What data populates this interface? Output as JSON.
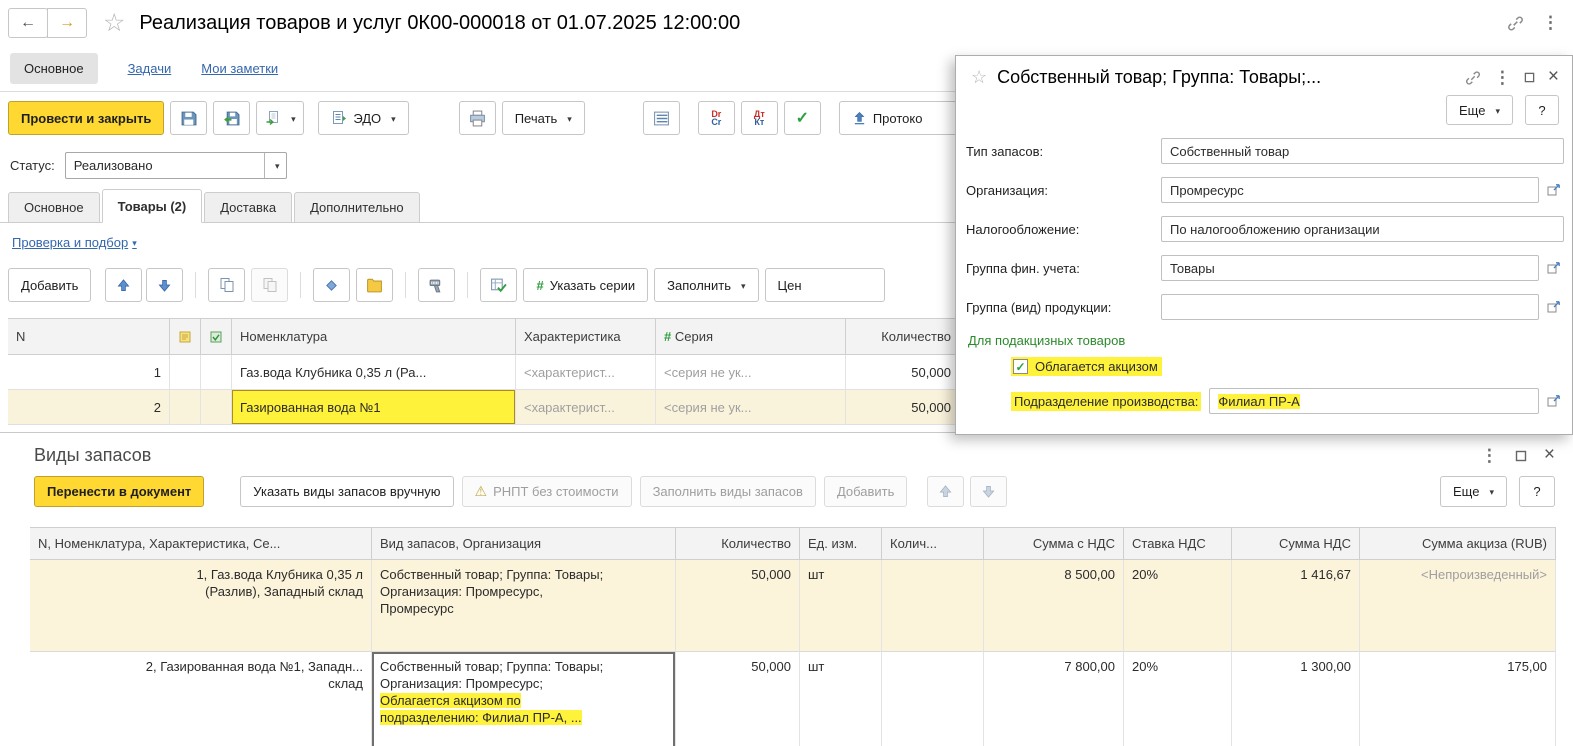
{
  "window": {
    "title": "Реализация товаров и услуг 0К00-000018 от 01.07.2025 12:00:00"
  },
  "nav": {
    "main": "Основное",
    "tasks": "Задачи",
    "notes": "Мои заметки"
  },
  "toolbar": {
    "post_and_close": "Провести и закрыть",
    "edo": "ЭДО",
    "print": "Печать",
    "dr_top": "Dr",
    "dr_bottom": "Cr",
    "dt_top": "Дт",
    "dt_bottom": "Кт",
    "protocol": "Протоко"
  },
  "status": {
    "label": "Статус:",
    "value": "Реализовано"
  },
  "doc_tabs": {
    "main": "Основное",
    "goods": "Товары (2)",
    "delivery": "Доставка",
    "additional": "Дополнительно"
  },
  "links": {
    "check_and_pick": "Проверка и подбор"
  },
  "items": {
    "toolbar": {
      "add": "Добавить",
      "specify_series": "Указать серии",
      "fill": "Заполнить",
      "prices": "Цен"
    },
    "headers": {
      "n": "N",
      "nomenclature": "Номенклатура",
      "characteristic": "Характеристика",
      "series": "Серия",
      "quantity": "Количество"
    },
    "rows": [
      {
        "n": "1",
        "nomenclature": "Газ.вода Клубника 0,35 л (Ра...",
        "characteristic": "<характерист...",
        "series": "<серия не ук...",
        "quantity": "50,000"
      },
      {
        "n": "2",
        "nomenclature": "Газированная вода №1",
        "characteristic": "<характерист...",
        "series": "<серия не ук...",
        "quantity": "50,000"
      }
    ]
  },
  "card": {
    "title": "Собственный товар; Группа: Товары;...",
    "more": "Еще",
    "help": "?",
    "type_label": "Тип запасов:",
    "type_value": "Собственный товар",
    "org_label": "Организация:",
    "org_value": "Промресурс",
    "tax_label": "Налогообложение:",
    "tax_value": "По налогообложению организации",
    "fin_group_label": "Группа фин. учета:",
    "fin_group_value": "Товары",
    "prod_group_label": "Группа (вид) продукции:",
    "prod_group_value": "",
    "excise_group": "Для подакцизных товаров",
    "excise_checkbox": "Облагается акцизом",
    "division_label": "Подразделение производства:",
    "division_value": "Филиал ПР-А"
  },
  "stock": {
    "title": "Виды запасов",
    "toolbar": {
      "transfer": "Перенести в документ",
      "manual": "Указать виды запасов вручную",
      "rnpt": "РНПТ без стоимости",
      "fill": "Заполнить виды запасов",
      "add": "Добавить",
      "more": "Еще",
      "help": "?"
    },
    "headers": {
      "item": "N, Номенклатура, Характеристика, Се...",
      "kind": "Вид запасов, Организация",
      "quantity": "Количество",
      "unit": "Ед. изм.",
      "qty2": "Колич...",
      "sum_vat": "Сумма с НДС",
      "vat_rate": "Ставка НДС",
      "vat_sum": "Сумма НДС",
      "excise_sum": "Сумма акциза (RUB)"
    },
    "rows": [
      {
        "item": "1, Газ.вода Клубника 0,35 л\n(Разлив), Западный склад",
        "kind": "Собственный товар; Группа: Товары;\nОрганизация: Промресурс,\nПромресурс",
        "kind_highlight": "",
        "quantity": "50,000",
        "unit": "шт",
        "sum_vat": "8 500,00",
        "vat_rate": "20%",
        "vat_sum": "1 416,67",
        "excise_sum": "<Непроизведенный>"
      },
      {
        "item": "2, Газированная вода №1, Западн...\nсклад",
        "kind": "Собственный товар; Группа: Товары;\nОрганизация: Промресурс;\n",
        "kind_highlight": "Облагается акцизом по\nподразделению: Филиал ПР-А, ...",
        "quantity": "50,000",
        "unit": "шт",
        "sum_vat": "7 800,00",
        "vat_rate": "20%",
        "vat_sum": "1 300,00",
        "excise_sum": "175,00"
      }
    ]
  }
}
